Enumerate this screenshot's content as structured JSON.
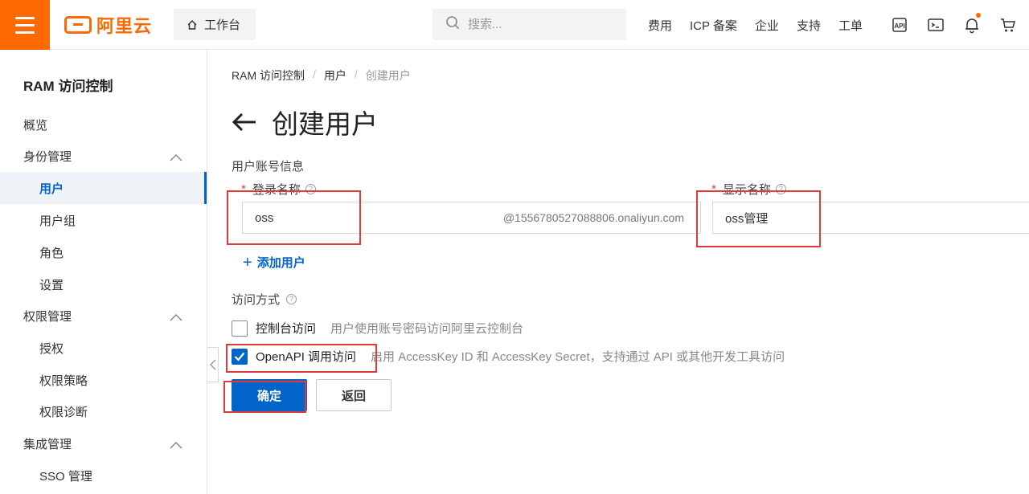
{
  "topbar": {
    "brand": "阿里云",
    "workbench_label": "工作台",
    "search_placeholder": "搜索...",
    "links": [
      "费用",
      "ICP 备案",
      "企业",
      "支持",
      "工单"
    ],
    "icons": [
      "api-icon",
      "terminal-icon",
      "bell-icon",
      "cart-icon"
    ],
    "brand_color": "#ff6a00"
  },
  "sidebar": {
    "title": "RAM 访问控制",
    "items": [
      {
        "label": "概览",
        "level": 1
      },
      {
        "label": "身份管理",
        "level": 1,
        "expandable": true
      },
      {
        "label": "用户",
        "level": 2,
        "active": true
      },
      {
        "label": "用户组",
        "level": 2
      },
      {
        "label": "角色",
        "level": 2
      },
      {
        "label": "设置",
        "level": 2
      },
      {
        "label": "权限管理",
        "level": 1,
        "expandable": true
      },
      {
        "label": "授权",
        "level": 2
      },
      {
        "label": "权限策略",
        "level": 2
      },
      {
        "label": "权限诊断",
        "level": 2
      },
      {
        "label": "集成管理",
        "level": 1,
        "expandable": true
      },
      {
        "label": "SSO 管理",
        "level": 2
      }
    ],
    "accent_color": "#0064c8"
  },
  "breadcrumb": [
    "RAM 访问控制",
    "用户",
    "创建用户"
  ],
  "page": {
    "title": "创建用户",
    "section_label": "用户账号信息",
    "login_name_label": "登录名称",
    "login_name_value": "oss",
    "login_name_suffix": "@1556780527088806.onaliyun.com",
    "display_name_label": "显示名称",
    "display_name_value": "oss管理",
    "required_mark": "*",
    "help_mark": "?",
    "add_user_label": "添加用户",
    "access_label": "访问方式",
    "access_options": [
      {
        "label": "控制台访问",
        "desc": "用户使用账号密码访问阿里云控制台",
        "checked": false
      },
      {
        "label": "OpenAPI 调用访问",
        "desc": "启用 AccessKey ID 和 AccessKey Secret，支持通过 API 或其他开发工具访问",
        "checked": true
      }
    ],
    "confirm_label": "确定",
    "back_label": "返回"
  }
}
